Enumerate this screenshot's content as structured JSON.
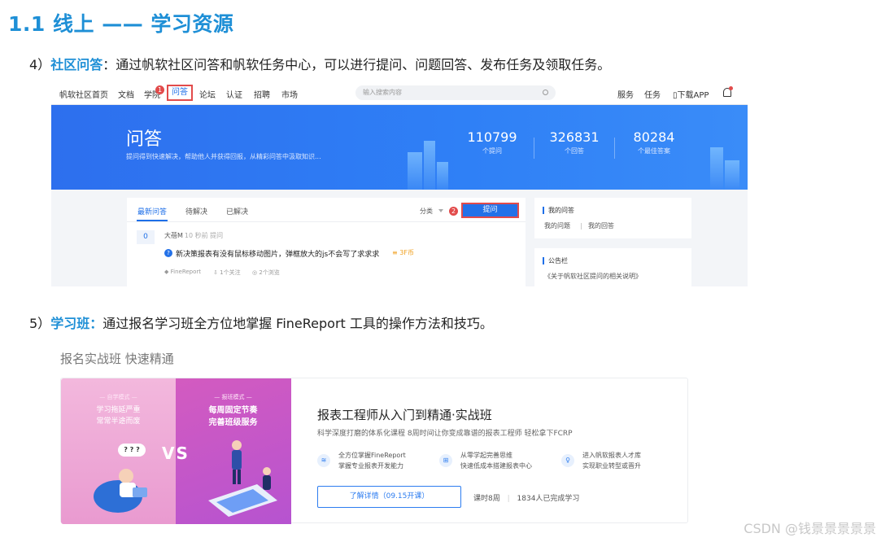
{
  "slide": {
    "title": "1.1 线上 —— 学习资源",
    "item4": {
      "prefix": "4）",
      "highlight": "社区问答",
      "text": "：通过帆软社区问答和帆软任务中心，可以进行提问、问题回答、发布任务及领取任务。"
    },
    "item5": {
      "prefix": "5）",
      "highlight": "学习班：",
      "text": "通过报名学习班全方位地掌握 FineReport 工具的操作方法和技巧。"
    }
  },
  "community": {
    "nav": {
      "items": [
        "帆软社区首页",
        "文档",
        "学院",
        "问答",
        "论坛",
        "认证",
        "招聘",
        "市场"
      ],
      "badge": "1",
      "search_placeholder": "输入搜索内容",
      "right": [
        "服务",
        "任务",
        "下载APP"
      ]
    },
    "banner": {
      "title": "问答",
      "subtitle": "提问得到快速解决，帮助他人并获得回报，从精彩问答中汲取知识...",
      "stats": [
        {
          "value": "110799",
          "label": "个提问"
        },
        {
          "value": "326831",
          "label": "个回答"
        },
        {
          "value": "80284",
          "label": "个最佳答案"
        }
      ]
    },
    "questions": {
      "tabs": [
        "最新问答",
        "待解决",
        "已解决"
      ],
      "classify": "分类",
      "badge": "2",
      "ask_button": "提问",
      "item": {
        "count": "0",
        "asker": "大蓓M",
        "time": "10 秒前 提问",
        "text": "新决策报表有没有鼠标移动图片，弹框放大的js不会写了求求求",
        "reward": "3F币",
        "tag": "FineReport",
        "follows": "1个关注",
        "views": "2个浏览"
      }
    },
    "side": {
      "my_title": "我的问答",
      "my_links": [
        "我的问题",
        "我的回答"
      ],
      "notice_title": "公告栏",
      "notice_link": "《关于帆软社区提问的相关说明》"
    }
  },
  "course": {
    "section_title": "报名实战班 快速精通",
    "promo": {
      "left_tag": "— 自学模式 —",
      "left_lines": [
        "学习拖延严重",
        "常常半途而废"
      ],
      "right_tag": "— 报班模式 —",
      "right_lines": [
        "每周固定节奏",
        "完善班级服务"
      ],
      "vs": "VS",
      "bubble": "? ? ?"
    },
    "title": "报表工程师从入门到精通·实战班",
    "subtitle": "科学深度打磨的体系化课程 8周时间让你变成靠谱的报表工程师 轻松拿下FCRP",
    "features": [
      {
        "line1": "全方位掌握FineReport",
        "line2": "掌握专业报表开发能力"
      },
      {
        "line1": "从零学起完善思维",
        "line2": "快速低成本搭建报表中心"
      },
      {
        "line1": "进入帆软报表人才库",
        "line2": "实现职业转型或晋升"
      }
    ],
    "detail_button": "了解详情（09.15开课）",
    "duration": "课时8周",
    "completed": "1834人已完成学习"
  },
  "watermark": "CSDN @钱景景景景景"
}
